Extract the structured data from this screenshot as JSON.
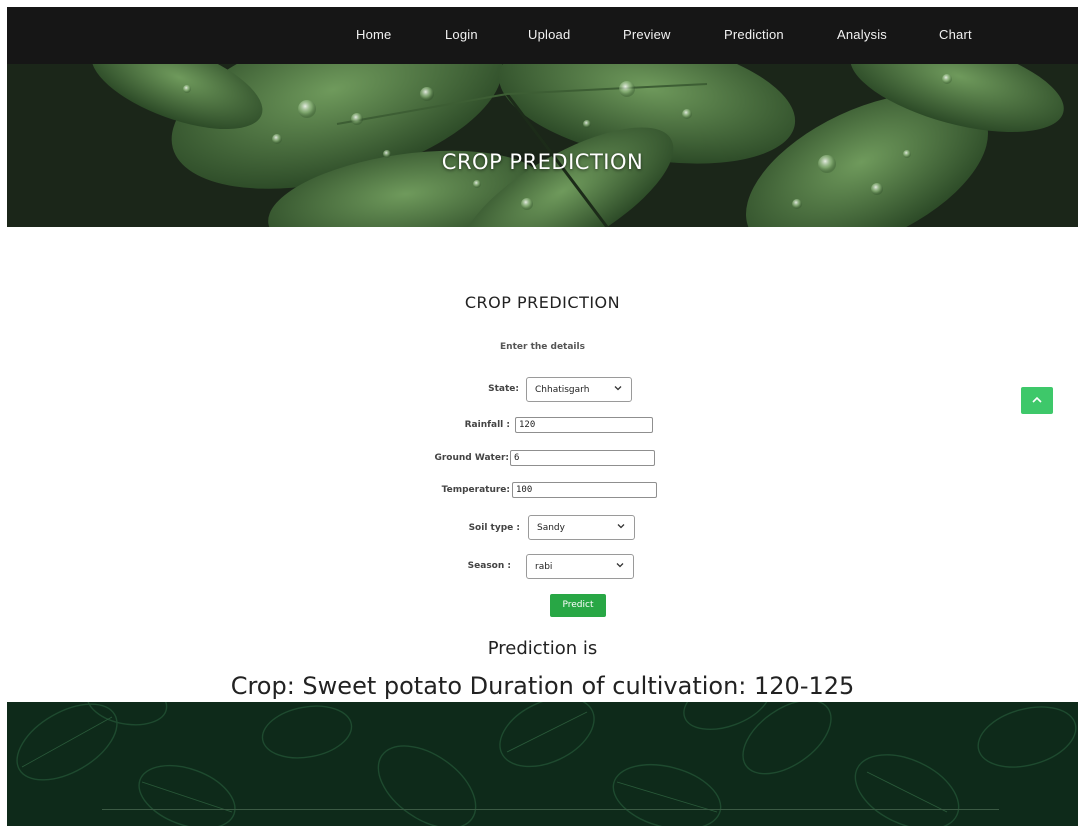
{
  "nav": {
    "items": [
      {
        "label": "Home"
      },
      {
        "label": "Login"
      },
      {
        "label": "Upload"
      },
      {
        "label": "Preview"
      },
      {
        "label": "Prediction"
      },
      {
        "label": "Analysis"
      },
      {
        "label": "Chart"
      }
    ]
  },
  "hero": {
    "title": "CROP PREDICTION"
  },
  "form": {
    "title": "CROP PREDICTION",
    "subtitle": "Enter the details",
    "state": {
      "label": "State:",
      "value": "Chhatisgarh"
    },
    "rainfall": {
      "label": "Rainfall :",
      "value": "120"
    },
    "ground_water": {
      "label": "Ground Water:",
      "value": "6"
    },
    "temperature": {
      "label": "Temperature:",
      "value": "100"
    },
    "soil_type": {
      "label": "Soil type :",
      "value": "Sandy"
    },
    "season": {
      "label": "Season :",
      "value": "rabi"
    },
    "predict_label": "Predict"
  },
  "result": {
    "label": "Prediction is",
    "text": "Crop: Sweet potato Duration of cultivation: 120-125"
  },
  "colors": {
    "nav_bg": "#161616",
    "button": "#28a745",
    "scroll_top": "#3ec86a",
    "footer_bg": "#0e2a1a"
  },
  "icons": {
    "scroll_top": "chevron-up-icon",
    "dropdown": "chevron-down-icon"
  }
}
